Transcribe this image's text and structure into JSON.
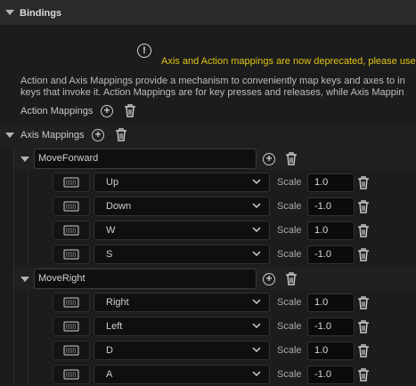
{
  "section": {
    "title": "Bindings"
  },
  "notice": {
    "icon": "info-icon",
    "info_glyph": "!",
    "text": "Axis and Action mappings are now deprecated, please use"
  },
  "description": {
    "line1": "Action and Axis Mappings provide a mechanism to conveniently map keys and axes to in",
    "line2": "keys that invoke it. Action Mappings are for key presses and releases, while Axis Mappin"
  },
  "action_mappings": {
    "label": "Action Mappings"
  },
  "axis_mappings": {
    "label": "Axis Mappings",
    "scale_label": "Scale",
    "groups": [
      {
        "name": "MoveForward",
        "keys": [
          {
            "key": "Up",
            "scale": "1.0"
          },
          {
            "key": "Down",
            "scale": "-1.0"
          },
          {
            "key": "W",
            "scale": "1.0"
          },
          {
            "key": "S",
            "scale": "-1.0"
          }
        ]
      },
      {
        "name": "MoveRight",
        "keys": [
          {
            "key": "Right",
            "scale": "1.0"
          },
          {
            "key": "Left",
            "scale": "-1.0"
          },
          {
            "key": "D",
            "scale": "1.0"
          },
          {
            "key": "A",
            "scale": "-1.0"
          }
        ]
      }
    ]
  },
  "colors": {
    "warning": "#e0c417",
    "background": "#1a1a1a"
  }
}
